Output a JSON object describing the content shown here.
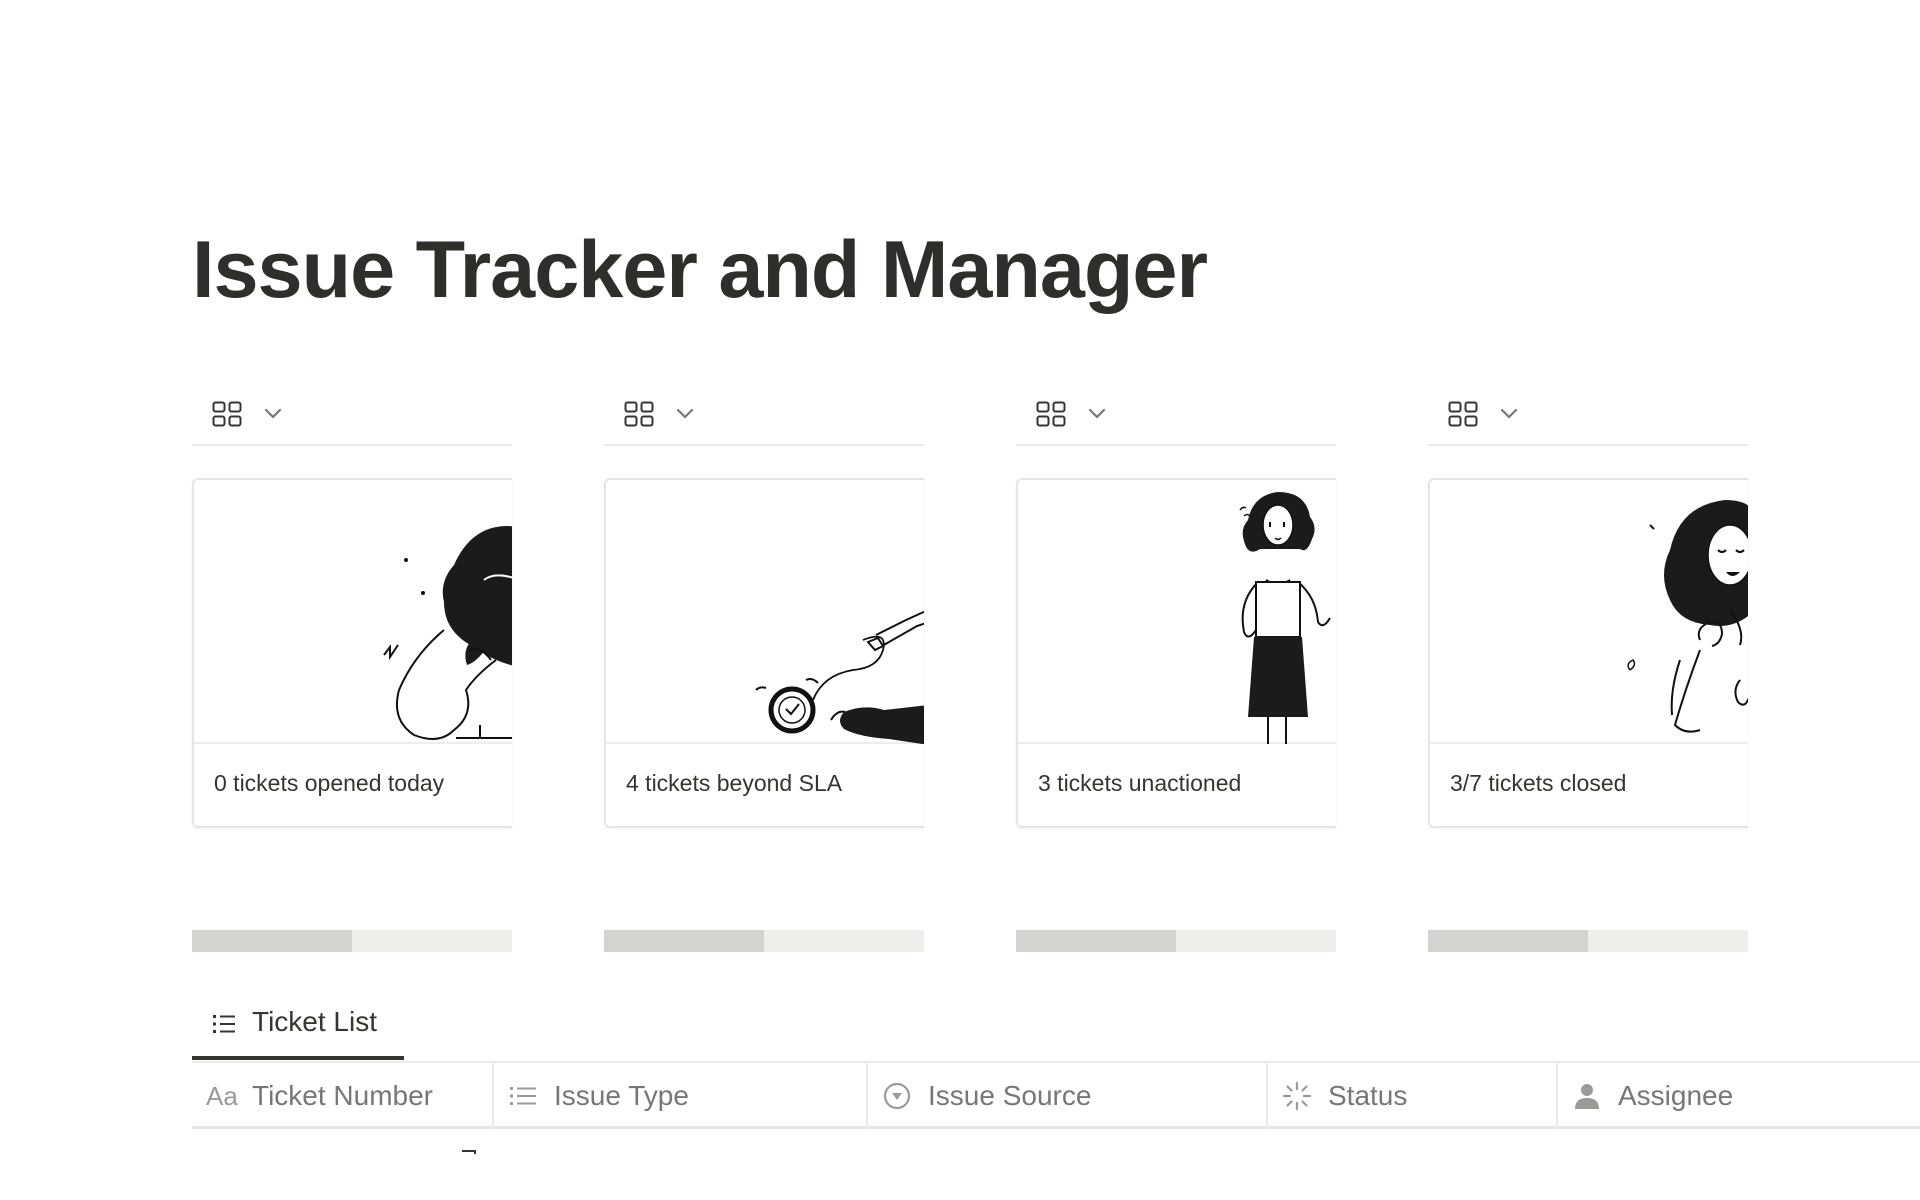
{
  "page": {
    "title": "Issue Tracker and Manager"
  },
  "galleries": [
    {
      "caption": "0 tickets opened today",
      "scroll_fraction": 0.5,
      "cover_icon": "woman-on-phone-illustration"
    },
    {
      "caption": "4 tickets beyond SLA",
      "scroll_fraction": 0.5,
      "cover_icon": "pocket-watch-illustration"
    },
    {
      "caption": "3 tickets unactioned",
      "scroll_fraction": 0.5,
      "cover_icon": "standing-woman-illustration"
    },
    {
      "caption": "3/7 tickets closed",
      "scroll_fraction": 0.5,
      "cover_icon": "cheering-woman-illustration"
    }
  ],
  "ticket_list": {
    "tab_label": "Ticket List",
    "tab_icon": "list-icon",
    "columns": [
      {
        "label": "Ticket Number",
        "icon": "Aa"
      },
      {
        "label": "Issue Type",
        "icon": "multi-select-icon"
      },
      {
        "label": "Issue Source",
        "icon": "select-icon"
      },
      {
        "label": "Status",
        "icon": "status-icon"
      },
      {
        "label": "Assignee",
        "icon": "person-icon"
      }
    ]
  }
}
